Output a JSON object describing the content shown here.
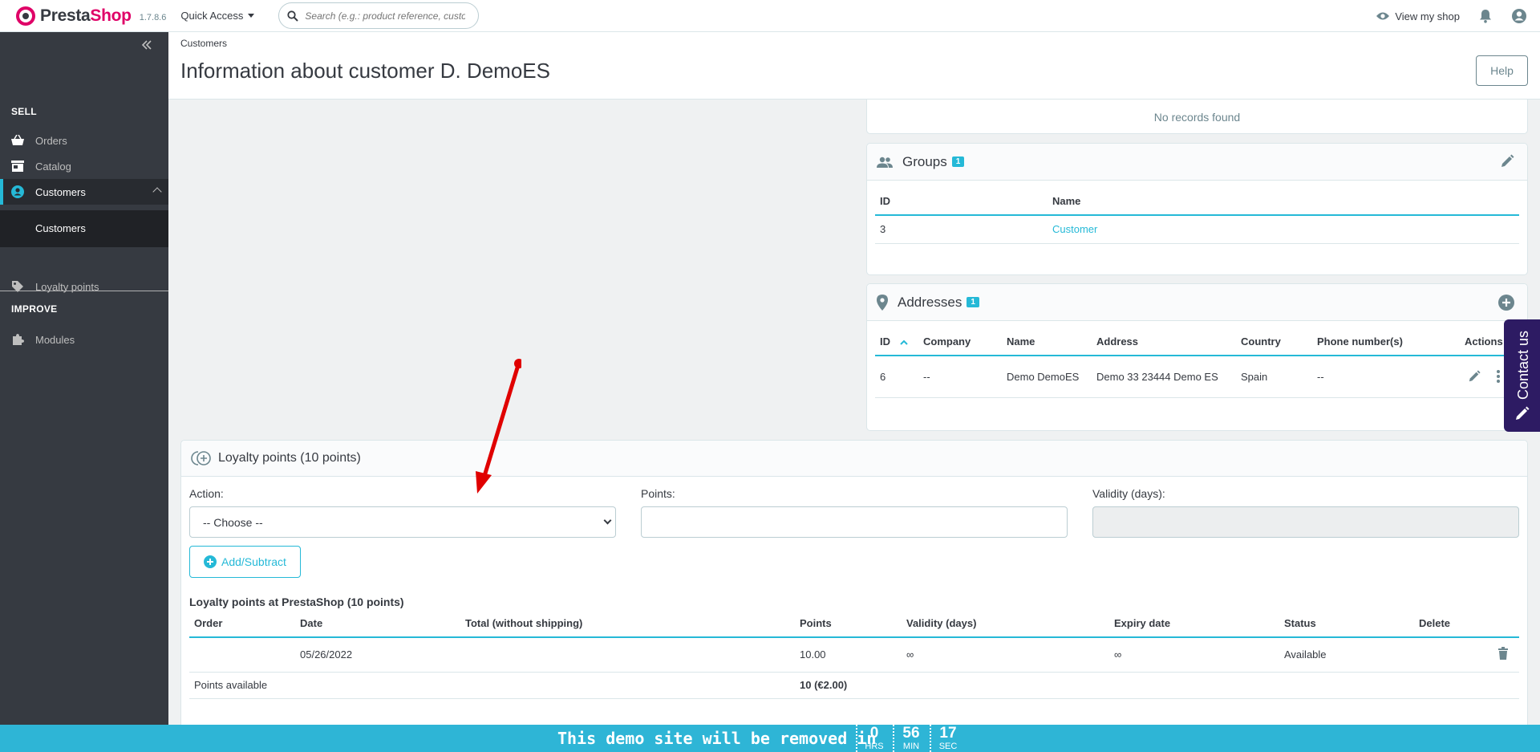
{
  "header": {
    "logo_prefix": "Presta",
    "logo_suffix": "Shop",
    "version": "1.7.8.6",
    "quick_access": "Quick Access",
    "search_placeholder": "Search (e.g.: product reference, custon",
    "view_shop": "View my shop"
  },
  "sidebar": {
    "sections": {
      "sell": "SELL",
      "improve": "IMPROVE"
    },
    "items": {
      "orders": "Orders",
      "catalog": "Catalog",
      "customers": "Customers",
      "customers_sub": "Customers",
      "loyalty": "Loyalty points",
      "modules": "Modules"
    }
  },
  "page": {
    "breadcrumb": "Customers",
    "title": "Information about customer D. DemoES",
    "help": "Help"
  },
  "messages": {
    "no_records": "No records found"
  },
  "groups": {
    "title": "Groups",
    "count": "1",
    "columns": [
      "ID",
      "Name"
    ],
    "rows": [
      {
        "id": "3",
        "name": "Customer"
      }
    ]
  },
  "addresses": {
    "title": "Addresses",
    "count": "1",
    "columns": [
      "ID",
      "Company",
      "Name",
      "Address",
      "Country",
      "Phone number(s)",
      "Actions"
    ],
    "rows": [
      {
        "id": "6",
        "company": "--",
        "name": "Demo DemoES",
        "address": "Demo 33 23444 Demo ES",
        "country": "Spain",
        "phone": "--"
      }
    ]
  },
  "contact_tab": "Contact us",
  "loyalty": {
    "title": "Loyalty points (10 points)",
    "action_label": "Action:",
    "action_selected": "-- Choose --",
    "points_label": "Points:",
    "points_value": "",
    "validity_label": "Validity (days):",
    "add_subtract": "Add/Subtract",
    "table_title": "Loyalty points at PrestaShop (10 points)",
    "columns": [
      "Order",
      "Date",
      "Total (without shipping)",
      "Points",
      "Validity (days)",
      "Expiry date",
      "Status",
      "Delete"
    ],
    "rows": [
      {
        "order": "",
        "date": "05/26/2022",
        "total": "",
        "points": "10.00",
        "validity": "∞",
        "expiry": "∞",
        "status": "Available"
      }
    ],
    "available_label": "Points available",
    "available_value": "10 (€2.00)"
  },
  "demo_banner": {
    "text": "This demo site will be removed in",
    "hours": "0",
    "hours_unit": "HRS",
    "minutes": "56",
    "minutes_unit": "MIN",
    "seconds": "17",
    "seconds_unit": "SEC"
  },
  "colors": {
    "accent": "#25b9d7",
    "brand": "#df0067",
    "sidebar": "#363a41",
    "contact": "#2d1b63",
    "annotation": "#e00000"
  }
}
